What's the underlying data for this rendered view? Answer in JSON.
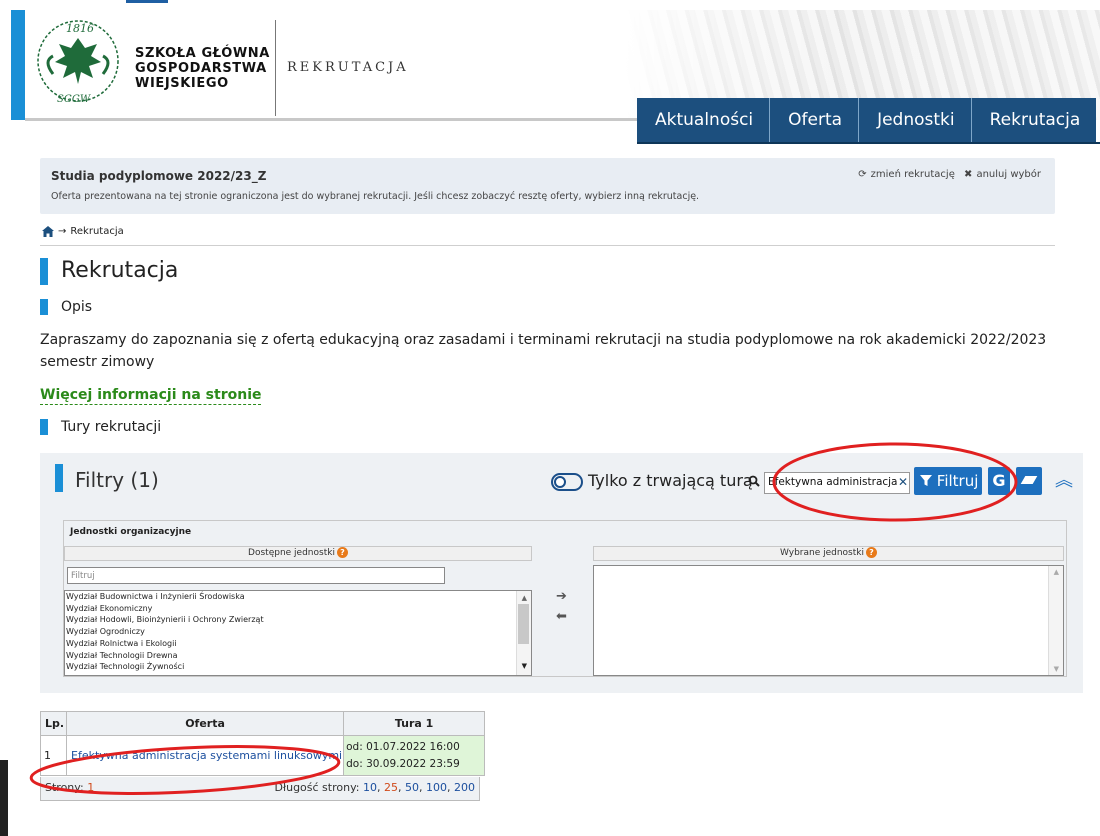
{
  "header": {
    "emblem_year": "1816",
    "emblem_abbr": "SGGW",
    "uni_name_lines": [
      "SZKOŁA GŁÓWNA",
      "GOSPODARSTWA",
      "WIEJSKIEGO"
    ],
    "section_name": "REKRUTACJA",
    "nav": [
      "Aktualności",
      "Oferta",
      "Jednostki",
      "Rekrutacja"
    ]
  },
  "context": {
    "title": "Studia podyplomowe 2022/23_Z",
    "description": "Oferta prezentowana na tej stronie ograniczona jest do wybranej rekrutacji. Jeśli chcesz zobaczyć resztę oferty, wybierz inną rekrutację.",
    "change_label": "zmień rekrutację",
    "cancel_label": "anuluj wybór"
  },
  "breadcrumb": {
    "arrow": "→",
    "current": "Rekrutacja"
  },
  "page": {
    "title": "Rekrutacja",
    "description_heading": "Opis",
    "intro": "Zapraszamy do zapoznania się z ofertą edukacyjną oraz zasadami i terminami rekrutacji na studia podyplomowe na rok akademicki 2022/2023 semestr zimowy",
    "more_link": "Więcej informacji na stronie",
    "rounds_heading": "Tury rekrutacji"
  },
  "filters": {
    "title": "Filtry (1)",
    "toggle_label": "Tylko z trwającą turą",
    "search_value": "Efektywna administracja",
    "filter_button": "Filtruj",
    "google_button": "G",
    "units_label": "Jednostki organizacyjne",
    "available_label": "Dostępne jednostki",
    "selected_label": "Wybrane jednostki",
    "filter_placeholder": "Filtruj",
    "available_units": [
      "Wydział Budownictwa i Inżynierii Środowiska",
      "Wydział Ekonomiczny",
      "Wydział Hodowli, Bioinżynierii i Ochrony Zwierząt",
      "Wydział Ogrodniczy",
      "Wydział Rolnictwa i Ekologii",
      "Wydział Technologii Drewna",
      "Wydział Technologii Żywności"
    ]
  },
  "table": {
    "headers": [
      "Lp.",
      "Oferta",
      "Tura 1"
    ],
    "rows": [
      {
        "lp": "1",
        "offer": "Efektywna administracja systemami linuksowymi",
        "from": "od: 01.07.2022 16:00",
        "to": "do: 30.09.2022 23:59"
      }
    ],
    "pages_label": "Strony:",
    "current_page": "1",
    "page_length_label": "Długość strony:",
    "page_lengths": [
      "10",
      "25",
      "50",
      "100",
      "200"
    ]
  },
  "colors": {
    "nav_bg": "#1c4f7e",
    "accent": "#1a8fd6",
    "button": "#1d6fbe",
    "link_green": "#2b8a1a",
    "annotation": "#e02020",
    "tura_bg": "#dff5d8"
  }
}
